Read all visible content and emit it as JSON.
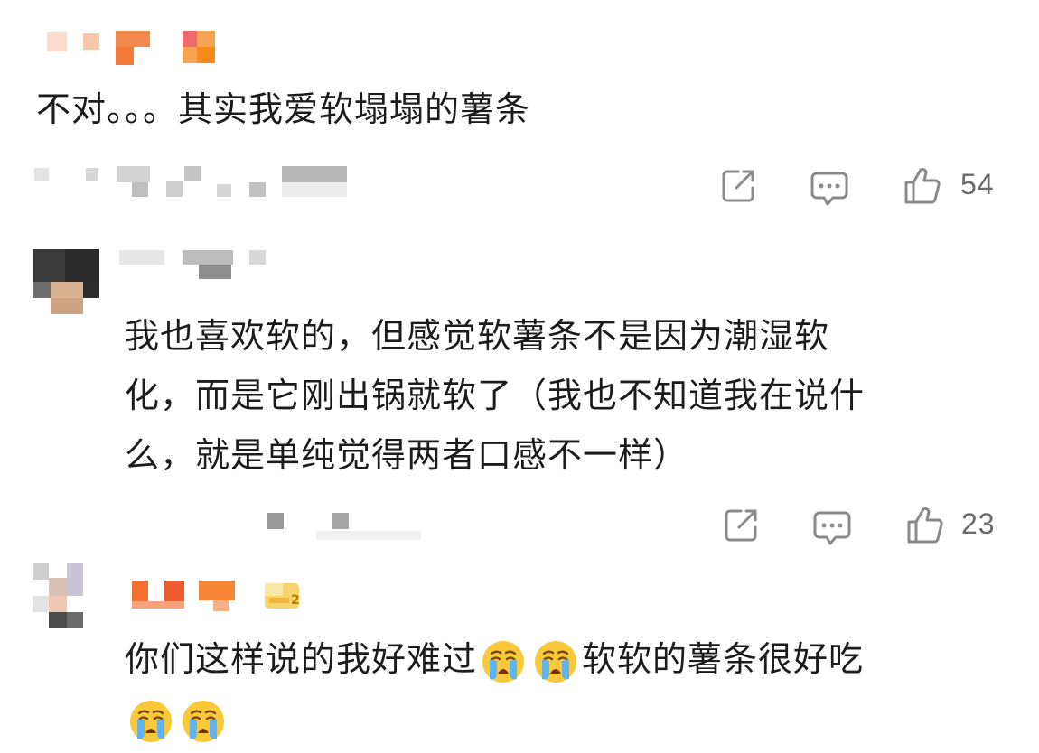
{
  "comments": [
    {
      "text": "不对。。。其实我爱软塌塌的薯条",
      "likes": "54"
    },
    {
      "text_lines": [
        "我也喜欢软的，但感觉软薯条不是因为潮湿软",
        "化，而是它刚出锅就软了（我也不知道我在说什",
        "么，就是单纯觉得两者口感不一样）"
      ],
      "likes": "23"
    },
    {
      "text_part1": "你们这样说的我好难过",
      "text_part2": "软软的薯条很好吃",
      "emoji": "crying-face"
    }
  ],
  "icons": [
    "share-icon",
    "comment-icon",
    "thumbs-up-icon",
    "crying-face-emoji"
  ],
  "colors": {
    "text": "#1c1c1c",
    "icon": "#8a8a8a",
    "count": "#6b6b6b",
    "badge": "#f5c842"
  }
}
